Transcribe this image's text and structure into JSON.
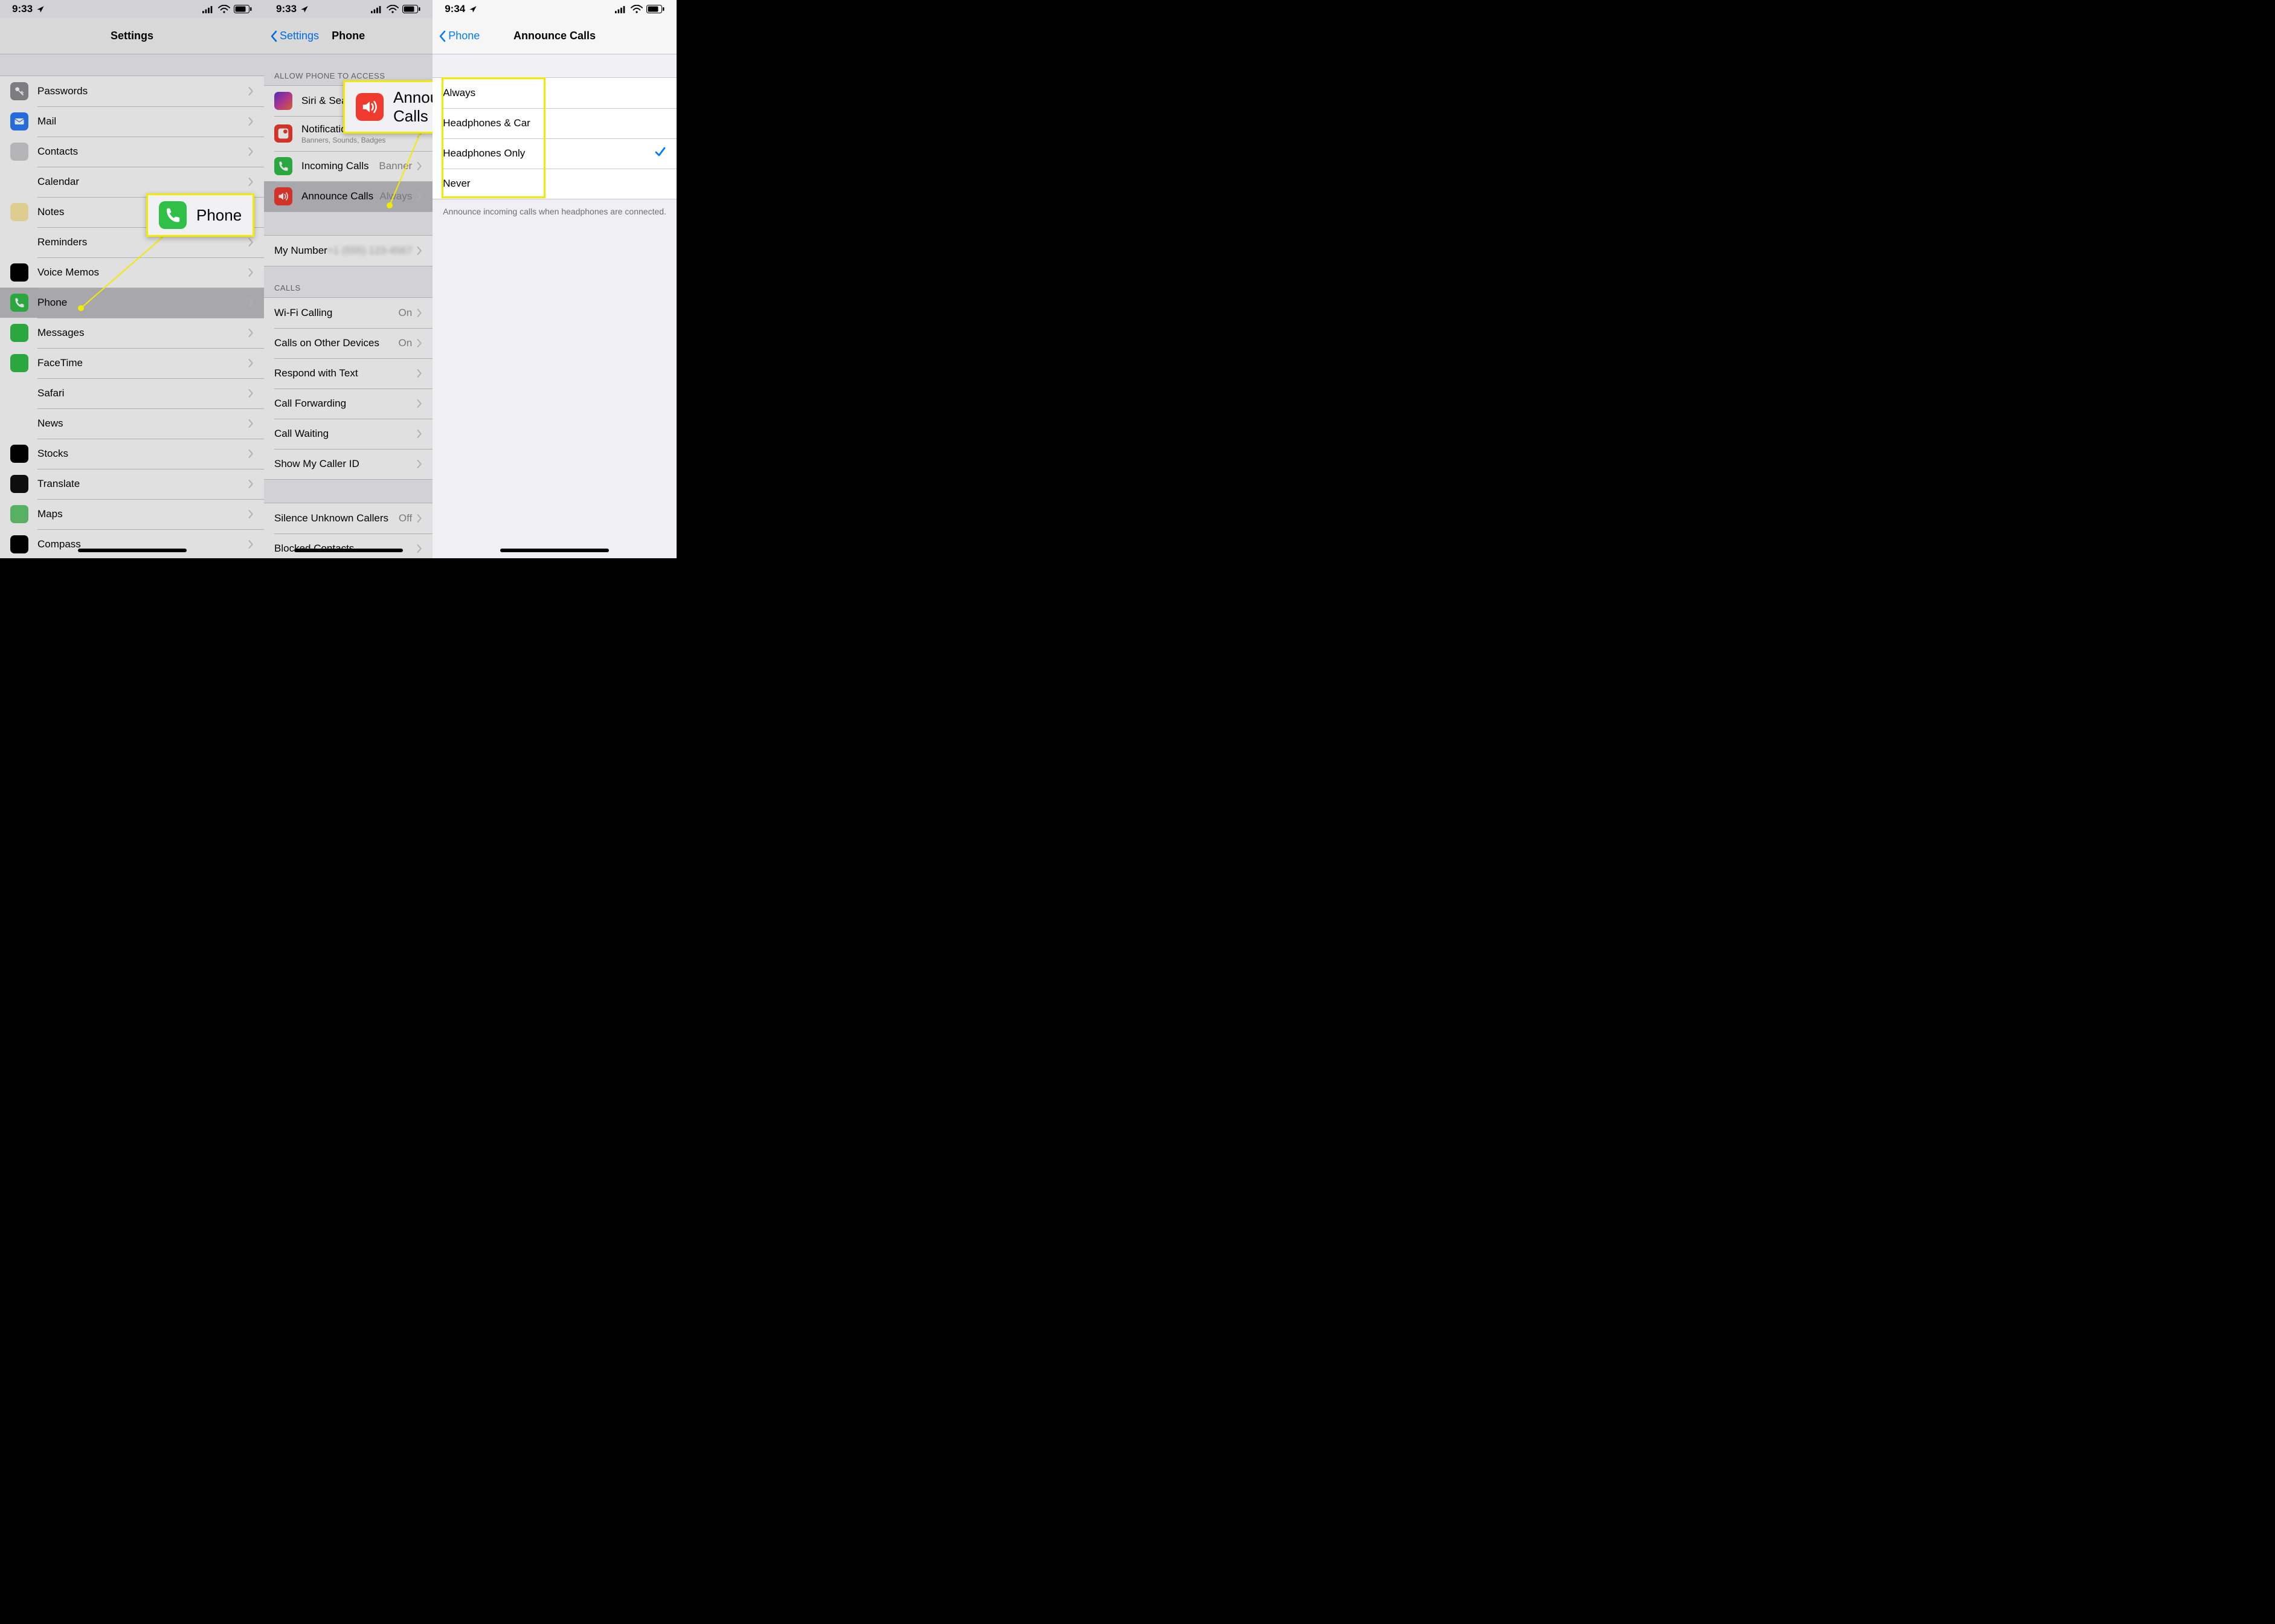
{
  "status": {
    "time": "9:33",
    "time_p3": "9:34"
  },
  "p1": {
    "nav_title": "Settings",
    "items": [
      {
        "label": "Passwords",
        "name": "passwords",
        "icon": "key",
        "bg": "#8e8e93"
      },
      {
        "label": "Mail",
        "name": "mail",
        "icon": "mail",
        "bg": "#2c7cf6"
      },
      {
        "label": "Contacts",
        "name": "contacts",
        "icon": "contacts",
        "bg": "#cfcfd2"
      },
      {
        "label": "Calendar",
        "name": "calendar",
        "icon": "calendar",
        "bg": "#ffffff"
      },
      {
        "label": "Notes",
        "name": "notes",
        "icon": "notes",
        "bg": "#fdeaa2"
      },
      {
        "label": "Reminders",
        "name": "reminders",
        "icon": "reminders",
        "bg": "#ffffff"
      },
      {
        "label": "Voice Memos",
        "name": "voice-memos",
        "icon": "voice",
        "bg": "#000000"
      },
      {
        "label": "Phone",
        "name": "phone",
        "icon": "phone",
        "bg": "#30c048",
        "selected": true
      },
      {
        "label": "Messages",
        "name": "messages",
        "icon": "messages",
        "bg": "#30c048"
      },
      {
        "label": "FaceTime",
        "name": "facetime",
        "icon": "facetime",
        "bg": "#30c048"
      },
      {
        "label": "Safari",
        "name": "safari",
        "icon": "safari",
        "bg": "#ffffff"
      },
      {
        "label": "News",
        "name": "news",
        "icon": "news",
        "bg": "#ffffff"
      },
      {
        "label": "Stocks",
        "name": "stocks",
        "icon": "stocks",
        "bg": "#000000"
      },
      {
        "label": "Translate",
        "name": "translate",
        "icon": "translate",
        "bg": "#111111"
      },
      {
        "label": "Maps",
        "name": "maps",
        "icon": "maps",
        "bg": "#65c971"
      },
      {
        "label": "Compass",
        "name": "compass",
        "icon": "compass",
        "bg": "#000000"
      }
    ],
    "callout": {
      "label": "Phone"
    }
  },
  "p2": {
    "back": "Settings",
    "nav_title": "Phone",
    "allow_header": "Allow Phone to Access",
    "rows_access": {
      "siri": {
        "label": "Siri & Search",
        "icon_bg": "#000"
      },
      "notifications": {
        "label": "Notifications",
        "sub": "Banners, Sounds, Badges",
        "icon_bg": "#ef3b2f"
      },
      "incoming": {
        "label": "Incoming Calls",
        "value": "Banner",
        "icon_bg": "#30c048"
      },
      "announce": {
        "label": "Announce Calls",
        "value": "Always",
        "icon_bg": "#ef3b2f"
      }
    },
    "my_number": {
      "label": "My Number",
      "value": "+1 (555) 123-4567"
    },
    "calls_header": "Calls",
    "rows_calls": [
      {
        "label": "Wi-Fi Calling",
        "name": "wifi-calling",
        "value": "On"
      },
      {
        "label": "Calls on Other Devices",
        "name": "calls-other-devices",
        "value": "On"
      },
      {
        "label": "Respond with Text",
        "name": "respond-with-text",
        "value": ""
      },
      {
        "label": "Call Forwarding",
        "name": "call-forwarding",
        "value": ""
      },
      {
        "label": "Call Waiting",
        "name": "call-waiting",
        "value": ""
      },
      {
        "label": "Show My Caller ID",
        "name": "show-caller-id",
        "value": ""
      }
    ],
    "rows_bottom": [
      {
        "label": "Silence Unknown Callers",
        "name": "silence-unknown",
        "value": "Off"
      },
      {
        "label": "Blocked Contacts",
        "name": "blocked-contacts",
        "value": ""
      }
    ],
    "callout": {
      "label": "Announce Calls"
    }
  },
  "p3": {
    "back": "Phone",
    "nav_title": "Announce Calls",
    "options": [
      {
        "label": "Always",
        "name": "option-always",
        "checked": false
      },
      {
        "label": "Headphones & Car",
        "name": "option-headphones-car",
        "checked": false
      },
      {
        "label": "Headphones Only",
        "name": "option-headphones-only",
        "checked": true
      },
      {
        "label": "Never",
        "name": "option-never",
        "checked": false
      }
    ],
    "footer": "Announce incoming calls when headphones are connected."
  }
}
